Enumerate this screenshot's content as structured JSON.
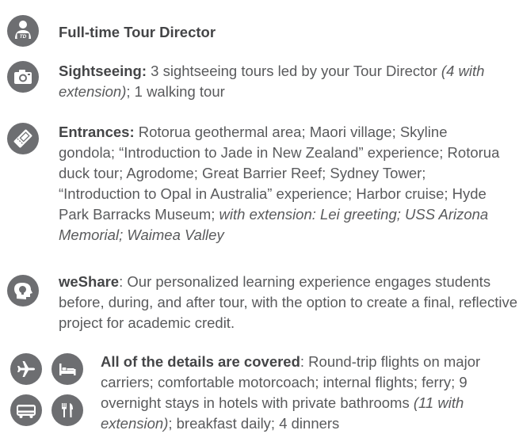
{
  "items": [
    {
      "icon": "tour-director-icon",
      "heading": "Full-time Tour Director",
      "icon_label": "TD"
    },
    {
      "icon": "camera-icon",
      "heading": "Sightseeing:",
      "body": " 3 sightseeing tours led by your Tour Director ",
      "body_italic": "(4 with extension)",
      "body_end": "; 1 walking tour"
    },
    {
      "icon": "ticket-icon",
      "heading": "Entrances:",
      "body": " Rotorua geothermal area; Maori village; Skyline gondola; “Introduction to Jade in New Zealand” experience; Rotorua duck tour; Agrodome; Great Barrier Reef; Sydney Tower; “Introduction to Opal in Australia” experience; Harbor cruise; Hyde Park Barracks Museum; ",
      "body_italic": "with extension: Lei greeting; USS Arizona Memorial; Waimea Valley"
    },
    {
      "icon": "head-lightbulb-icon",
      "heading": "weShare",
      "body": ": Our personalized learning experience engages students before, during, and after tour, with the option to create a final, reflective project for academic credit."
    },
    {
      "icons": [
        "airplane-icon",
        "bed-icon",
        "bus-icon",
        "dining-icon"
      ],
      "heading": "All of the details are covered",
      "body": ": Round-trip flights on major carriers; comfortable motorcoach; internal flights; ferry; 9 overnight stays in hotels with private bathrooms ",
      "body_italic": "(11 with extension)",
      "body_end": "; breakfast daily; 4 dinners"
    }
  ],
  "colors": {
    "icon_bg": "#6d6e71",
    "text": "#595a5c",
    "heading": "#444547"
  }
}
